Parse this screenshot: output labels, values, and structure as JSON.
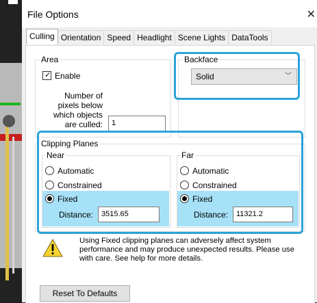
{
  "window": {
    "title": "File Options",
    "close_glyph": "✕"
  },
  "tabs": [
    "Culling",
    "Orientation",
    "Speed",
    "Headlight",
    "Scene Lights",
    "DataTools"
  ],
  "active_tab": "Culling",
  "area": {
    "label": "Area",
    "enable_label": "Enable",
    "enable_checked": true,
    "pixels_label_lines": [
      "Number of",
      "pixels below",
      "which objects",
      "are culled:"
    ],
    "pixels_value": "1"
  },
  "backface": {
    "label": "Backface",
    "value": "Solid"
  },
  "clipping": {
    "label": "Clipping Planes",
    "near": {
      "label": "Near",
      "options": [
        "Automatic",
        "Constrained",
        "Fixed"
      ],
      "selected": "Fixed",
      "distance_label": "Distance:",
      "distance_value": "3515.65"
    },
    "far": {
      "label": "Far",
      "options": [
        "Automatic",
        "Constrained",
        "Fixed"
      ],
      "selected": "Fixed",
      "distance_label": "Distance:",
      "distance_value": "11321.2"
    }
  },
  "warning": {
    "lines": [
      "Using Fixed clipping planes can adversely affect system",
      "performance and may produce unexpected results. Please use",
      "with care. See help for more details."
    ]
  },
  "reset_button": "Reset To Defaults",
  "colors": {
    "callout": "#2aa3d8",
    "selected_highlight": "#a6e1f7",
    "warning_yellow": "#f7d32e"
  }
}
